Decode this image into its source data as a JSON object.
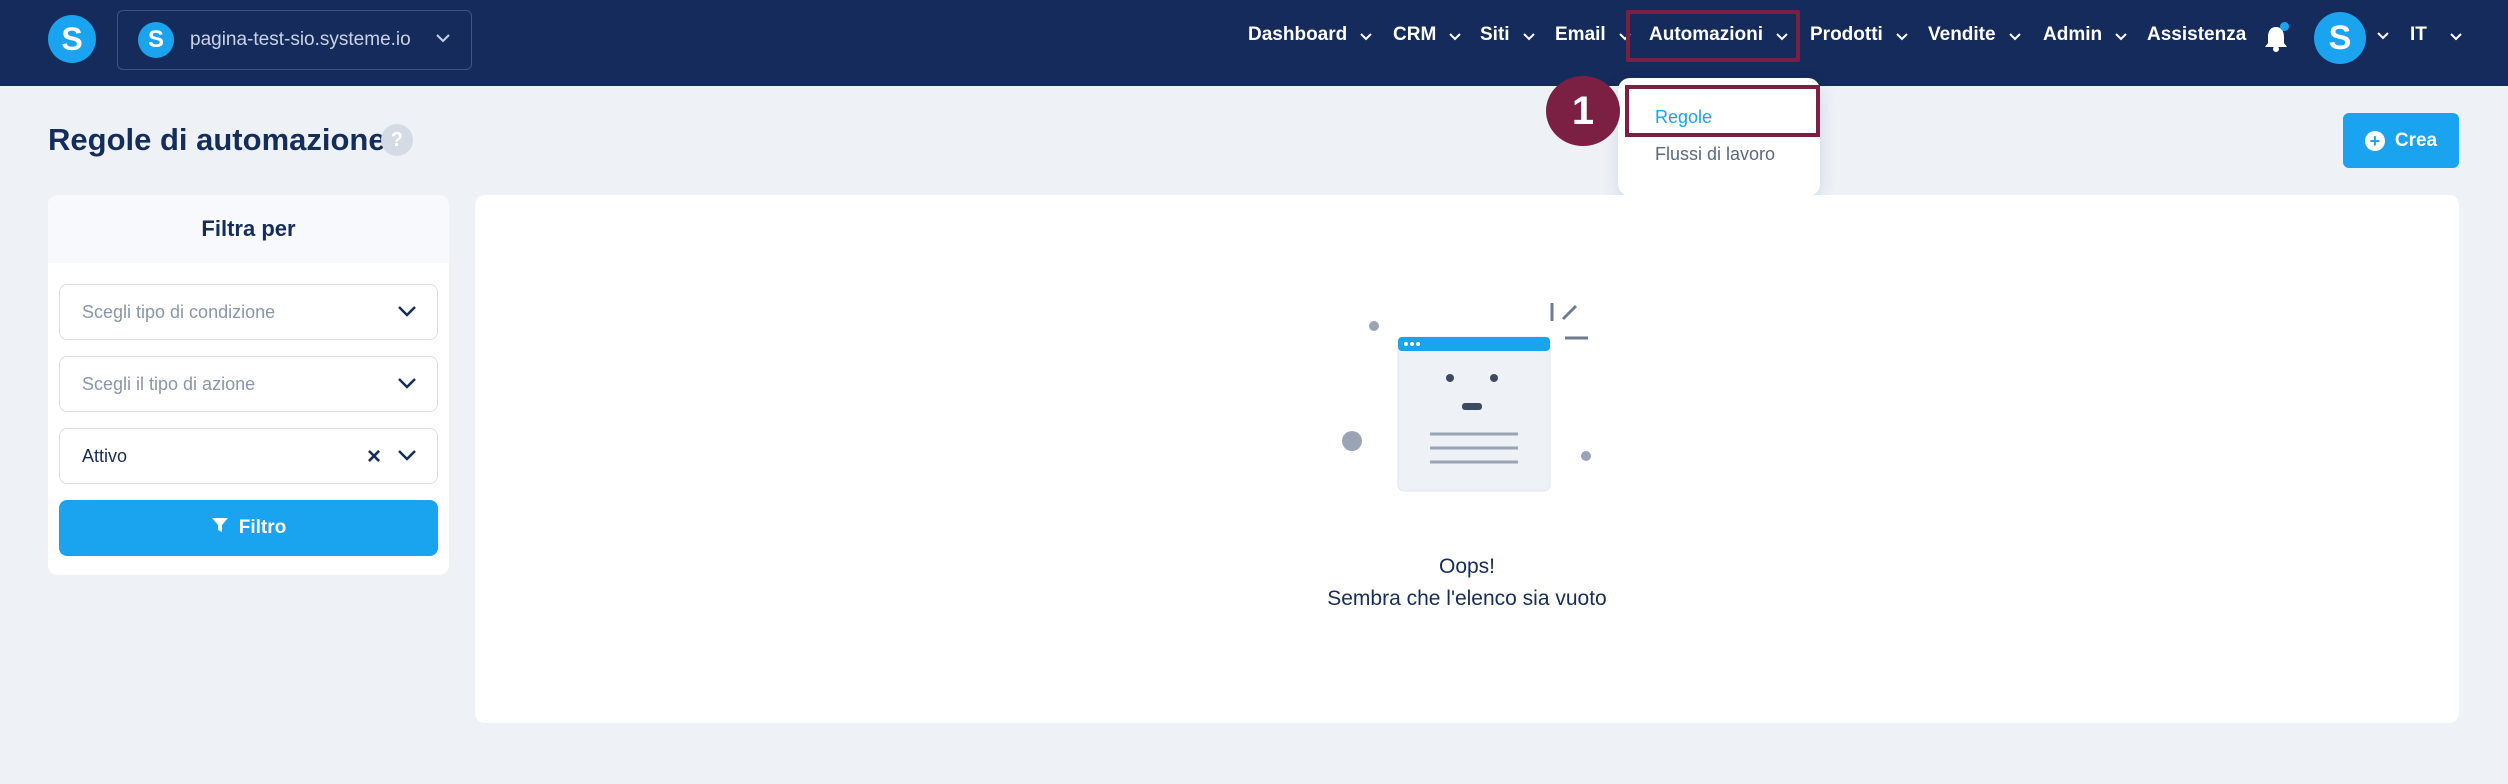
{
  "topbar": {
    "site_name": "pagina-test-sio.systeme.io",
    "logo_letter": "S",
    "avatar_letter": "S",
    "language": "IT",
    "nav": [
      {
        "label": "Dashboard"
      },
      {
        "label": "CRM"
      },
      {
        "label": "Siti"
      },
      {
        "label": "Email"
      },
      {
        "label": "Automazioni"
      },
      {
        "label": "Prodotti"
      },
      {
        "label": "Vendite"
      },
      {
        "label": "Admin"
      },
      {
        "label": "Assistenza"
      }
    ]
  },
  "dropdown": {
    "items": [
      {
        "label": "Regole"
      },
      {
        "label": "Flussi di lavoro"
      }
    ],
    "step_badge": "1"
  },
  "page": {
    "title": "Regole di automazione",
    "help": "?",
    "create_label": "Crea"
  },
  "filter": {
    "heading": "Filtra per",
    "condition_placeholder": "Scegli tipo di condizione",
    "action_placeholder": "Scegli il tipo di azione",
    "status_value": "Attivo",
    "button_label": "Filtro"
  },
  "empty_state": {
    "title": "Oops!",
    "message": "Sembra che l'elenco sia vuoto"
  },
  "colors": {
    "nav_bg": "#152b5b",
    "accent": "#1aa3ef",
    "highlight": "#7b1f43",
    "page_bg": "#eef2f7"
  }
}
